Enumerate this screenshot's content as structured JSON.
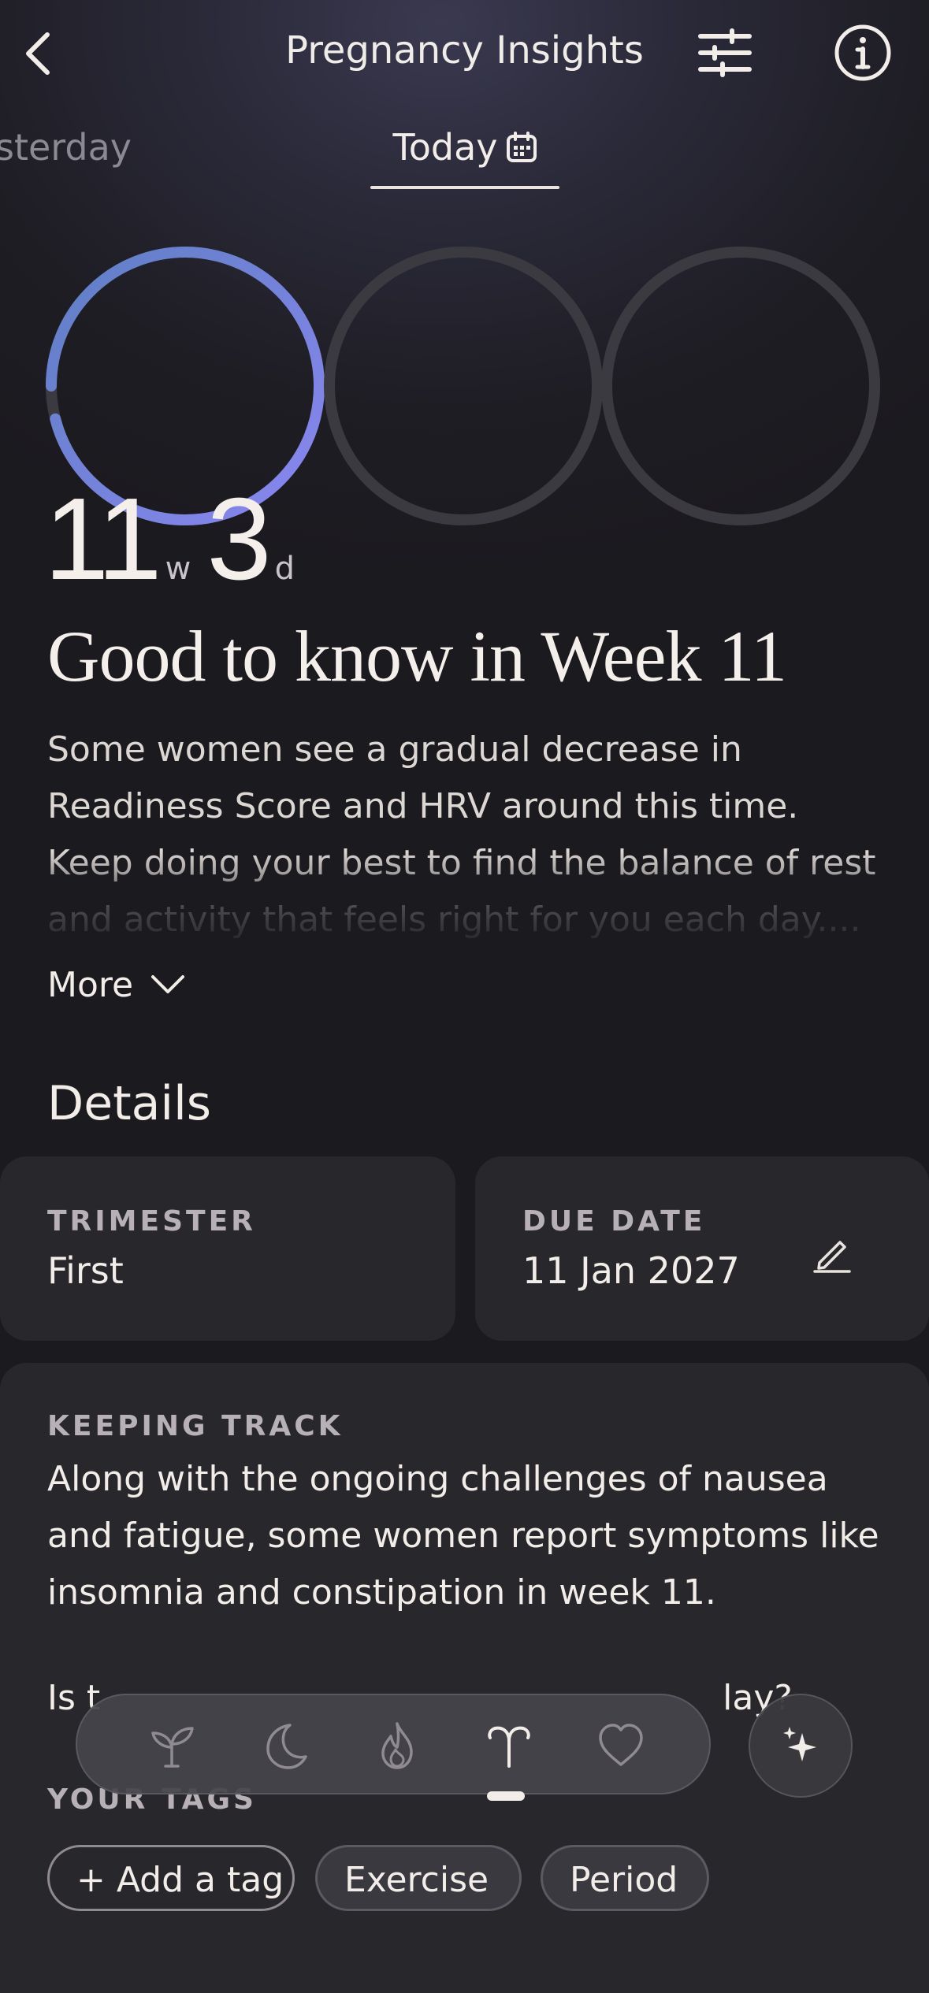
{
  "header": {
    "title": "Pregnancy Insights"
  },
  "day_tabs": {
    "previous_label": "sterday",
    "current_label": "Today"
  },
  "rings": {
    "trimester_progress": [
      0.96,
      0,
      0
    ],
    "accent_start": "#8a86f0",
    "accent_end": "#5f7fc4"
  },
  "pregnancy": {
    "weeks": "11",
    "weeks_unit": "w",
    "days": "3",
    "days_unit": "d"
  },
  "insight": {
    "title": "Good to know in Week 11",
    "body": "Some women see a gradual decrease in Readiness Score and HRV around this time. Keep doing your best to find the balance of rest and activity that feels right for you each day....",
    "more_label": "More"
  },
  "details": {
    "heading": "Details",
    "trimester_label": "TRIMESTER",
    "trimester_value": "First",
    "due_date_label": "DUE DATE",
    "due_date_value": "11 Jan 2027"
  },
  "keeping_track": {
    "label": "KEEPING TRACK",
    "body": "Along with the ongoing challenges of nausea and fatigue, some women report symptoms like insomnia and constipation in week 11.",
    "question_start": "Is t",
    "question_end": "lay?"
  },
  "tags": {
    "label": "YOUR TAGS",
    "add_label": "+ Add a tag",
    "items": [
      "Exercise",
      "Period"
    ]
  },
  "bottom_nav": {
    "items": [
      "sprout-icon",
      "moon-icon",
      "flame-icon",
      "pregnancy-icon",
      "heart-icon"
    ],
    "active_index": 3,
    "advisor_icon": "sparkle-icon"
  }
}
